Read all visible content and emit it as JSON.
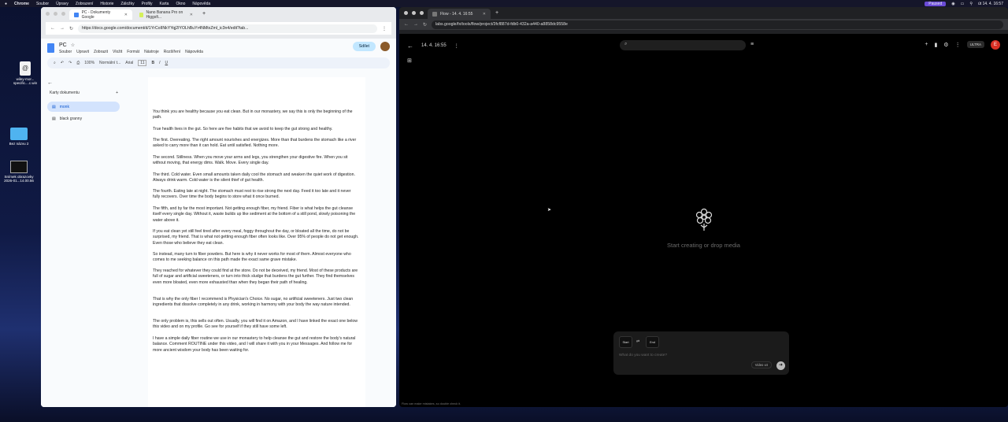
{
  "menubar": {
    "apple": "",
    "items": [
      "Chrome",
      "Soubor",
      "Úpravy",
      "Zobrazení",
      "Historie",
      "Záložky",
      "Profily",
      "Karta",
      "Okno",
      "Nápověda"
    ],
    "paused": "Paused",
    "clock": "út 14. 4.  16:57"
  },
  "desktop": {
    "icons": [
      {
        "label": "wiley-mor... specific....c.win"
      },
      {
        "label": "Bez názvu 2"
      },
      {
        "label": "Snímek obrazovky 2026-01...14.00.56"
      }
    ]
  },
  "left_window": {
    "tabs": [
      {
        "label": "PC - Dokumenty Google",
        "color": "#4285f4"
      },
      {
        "label": "Nano Banana Pro on Higgsfi...",
        "color": "#d4f05b"
      }
    ],
    "url": "https://docs.google.com/document/d/1YrCoIINkYYqj2IYOLhBuYr4NMtxZml_ic3n4/edit?tab...",
    "doc": {
      "title": "PC",
      "menu": [
        "Soubor",
        "Upravit",
        "Zobrazit",
        "Vložit",
        "Formát",
        "Nástroje",
        "Rozšíření",
        "Nápověda"
      ],
      "share": "Sdílet",
      "toolbar": {
        "zoom": "100%",
        "style": "Normální t...",
        "font": "Arial",
        "size": "11"
      },
      "outline": {
        "heading": "Karty dokumentu",
        "add": "+",
        "items": [
          {
            "label": "monk",
            "selected": true
          },
          {
            "label": "black granny",
            "selected": false
          }
        ]
      },
      "paragraphs": [
        "You think you are healthy because you eat clean. But in our monastery, we say this is only the beginning of the path.",
        "True health lives in the gut. So here are five habits that we avoid to keep the gut strong and healthy.",
        "The first. Overeating. The right amount nourishes and energizes. More than that burdens the stomach like a river asked to carry more than it can hold. Eat until satisfied. Nothing more.",
        "The second. Stillness. When you move your arms and legs, you strengthen your digestive fire. When you sit without moving, that energy dims. Walk. Move. Every single day.",
        "The third. Cold water. Even small amounts taken daily cool the stomach and weaken the quiet work of digestion. Always drink warm. Cold water is the silent thief of gut health.",
        "The fourth. Eating late at night. The stomach must rest to rise strong the next day. Feed it too late and it never fully recovers. Over time the body begins to store what it once burned.",
        "The fifth, and by far the most important. Not getting enough fiber, my friend. Fiber is what helps the gut cleanse itself every single day. Without it, waste builds up like sediment at the bottom of a still pond, slowly poisoning the water above it.",
        "If you eat clean yet still feel tired after every meal, foggy throughout the day, or bloated all the time, do not be surprised, my friend. That is what not getting enough fiber often looks like. Over 95% of people do not get enough. Even those who believe they eat clean.",
        "So instead, many turn to fiber powders. But here is why it never works for most of them. Almost everyone who comes to me seeking balance on this path made the exact same grave mistake.",
        "They reached for whatever they could find at the store. Do not be deceived, my friend. Most of these products are full of sugar and artificial sweeteners, or turn into thick sludge that burdens the gut further. They find themselves even more bloated, even more exhausted than when they began their path of healing.",
        "That is why the only fiber I recommend is Physician's Choice. No sugar, no artificial sweeteners. Just two clean ingredients that dissolve completely in any drink, working in harmony with your body the way nature intended.",
        "The only problem is, this sells out often. Usually, you will find it on Amazon, and I have linked the exact one below this video and on my profile. Go see for yourself if they still have some left.",
        "I have a simple daily fiber routine we use in our monastery to help cleanse the gut and restore the body's natural balance. Comment ROUTINE under this video, and I will share it with you in your Messages. And follow me for more ancient wisdom your body has been waiting for."
      ]
    }
  },
  "right_window": {
    "tabs": [
      {
        "label": "Flow - 14. 4. 16:55"
      }
    ],
    "url": "labs.google/fx/tools/flow/project/3fcf887d-fdb0-432a-a440-a8858dc9558e",
    "project_title": "14. 4. 16:55",
    "badge": "ULTRA",
    "avatar_letter": "E",
    "empty_label": "Start creating or drop media",
    "composer": {
      "start": "Start",
      "end": "End",
      "placeholder": "What do you want to create?",
      "mode": "Video",
      "count": "x4"
    },
    "footnote": "Flow can make mistakes, so double check it."
  }
}
